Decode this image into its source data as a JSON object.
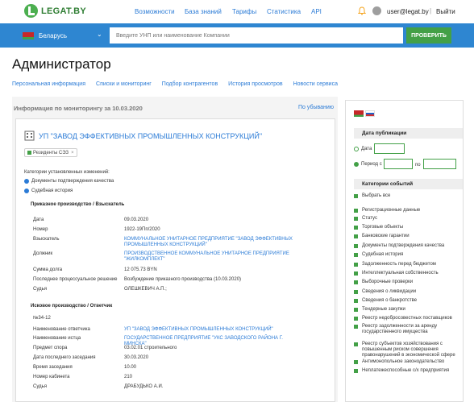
{
  "brand": "LEGAT.BY",
  "nav": [
    "Возможности",
    "База знаний",
    "Тарифы",
    "Статистика",
    "API"
  ],
  "user": {
    "email": "user@legat.by",
    "sep": "|",
    "logout": "Выйти"
  },
  "searchbar": {
    "country": "Беларусь",
    "placeholder": "Введите УНП или наименование Компании",
    "button": "ПРОВЕРИТЬ"
  },
  "page_title": "Администратор",
  "tabs": [
    "Персональная информация",
    "Списки и мониторинг",
    "Подбор контрагентов",
    "История просмотров",
    "Новости сервиса"
  ],
  "monitor": {
    "title": "Информация по мониторингу за 10.03.2020",
    "sort": "По убыванию",
    "company": "УП \"ЗАВОД ЭФФЕКТИВНЫХ ПРОМЫШЛЕННЫХ КОНСТРУКЦИЙ\"",
    "chip": "Резиденты СЭЗ",
    "chip_close": "×",
    "cat_label": "Категории установленных изменений:",
    "cats": [
      "Документы подтверждения качества",
      "Судебная история"
    ],
    "section1": "Приказное производство / Взыскатель",
    "rows1": [
      {
        "k": "Дата",
        "v": "09.03.2020"
      },
      {
        "k": "Номер",
        "v": "1922-19Пп/2020"
      },
      {
        "k": "Взыскатель",
        "v": "КОММУНАЛЬНОЕ УНИТАРНОЕ ПРЕДПРИЯТИЕ \"ЗАВОД ЭФФЕКТИВНЫХ ПРОМЫШЛЕННЫХ КОНСТРУКЦИЙ\""
      },
      {
        "k": "Должник",
        "v": "ПРОИЗВОДСТВЕННОЕ КОММУНАЛЬНОЕ УНИТАРНОЕ ПРЕДПРИЯТИЕ \"ЖИЛКОМПЛЕКТ\""
      },
      {
        "k": "Сумма долга",
        "v": "12 075.73 BYN"
      },
      {
        "k": "Последнее процессуальное решение",
        "v": "Возбуждение приказного производства (10.03.2020)"
      },
      {
        "k": "Судья",
        "v": "ОЛЕШКЕВИЧ А.П.;"
      }
    ],
    "section2": "Исковое производство / Ответчик",
    "case_no": "№34-12",
    "rows2": [
      {
        "k": "Наименование ответчика",
        "v": "УП \"ЗАВОД ЭФФЕКТИВНЫХ ПРОМЫШЛЕННЫХ КОНСТРУКЦИЙ\""
      },
      {
        "k": "Наименование истца",
        "v": "ГОСУДАРСТВЕННОЕ ПРЕДПРИЯТИЕ \"УКС ЗАВОДСКОГО РАЙОНА Г. МИНСКА\""
      },
      {
        "k": "Предмет спора",
        "v": "03.02.01 строительного"
      },
      {
        "k": "Дата последнего заседания",
        "v": "30.03.2020"
      },
      {
        "k": "Время заседания",
        "v": "10.00"
      },
      {
        "k": "Номер кабинета",
        "v": "210"
      },
      {
        "k": "Судья",
        "v": "ДРАБУДЬКО А.И."
      }
    ]
  },
  "sidebar": {
    "pub_title": "Дата публикации",
    "date_label": "Дата",
    "period_label": "Период с",
    "po_label": "по",
    "events_title": "Категории событий",
    "events": [
      "Выбрать все",
      "Регистрационные данные",
      "Статус",
      "Торговые объекты",
      "Банковские гарантии",
      "Документы подтверждения качества",
      "Судебная история",
      "Задолженность перед бюджетом",
      "Интеллектуальная собственность",
      "Выборочные проверки",
      "Сведения о ликвидации",
      "Сведения о банкротстве",
      "Тендерные закупки",
      "Реестр недобросовестных поставщиков",
      "Реестр задолженности за аренду государственного имущества",
      "Реестр субъектов хозяйствования с повышенным риском совершения правонарушений в экономической сфере",
      "Антимонопольное законодательство",
      "Неплатежеспособные с/х предприятия"
    ]
  },
  "colors": {
    "accent_blue": "#2e86d1",
    "green": "#43a047",
    "link": "#2b7bd6"
  }
}
